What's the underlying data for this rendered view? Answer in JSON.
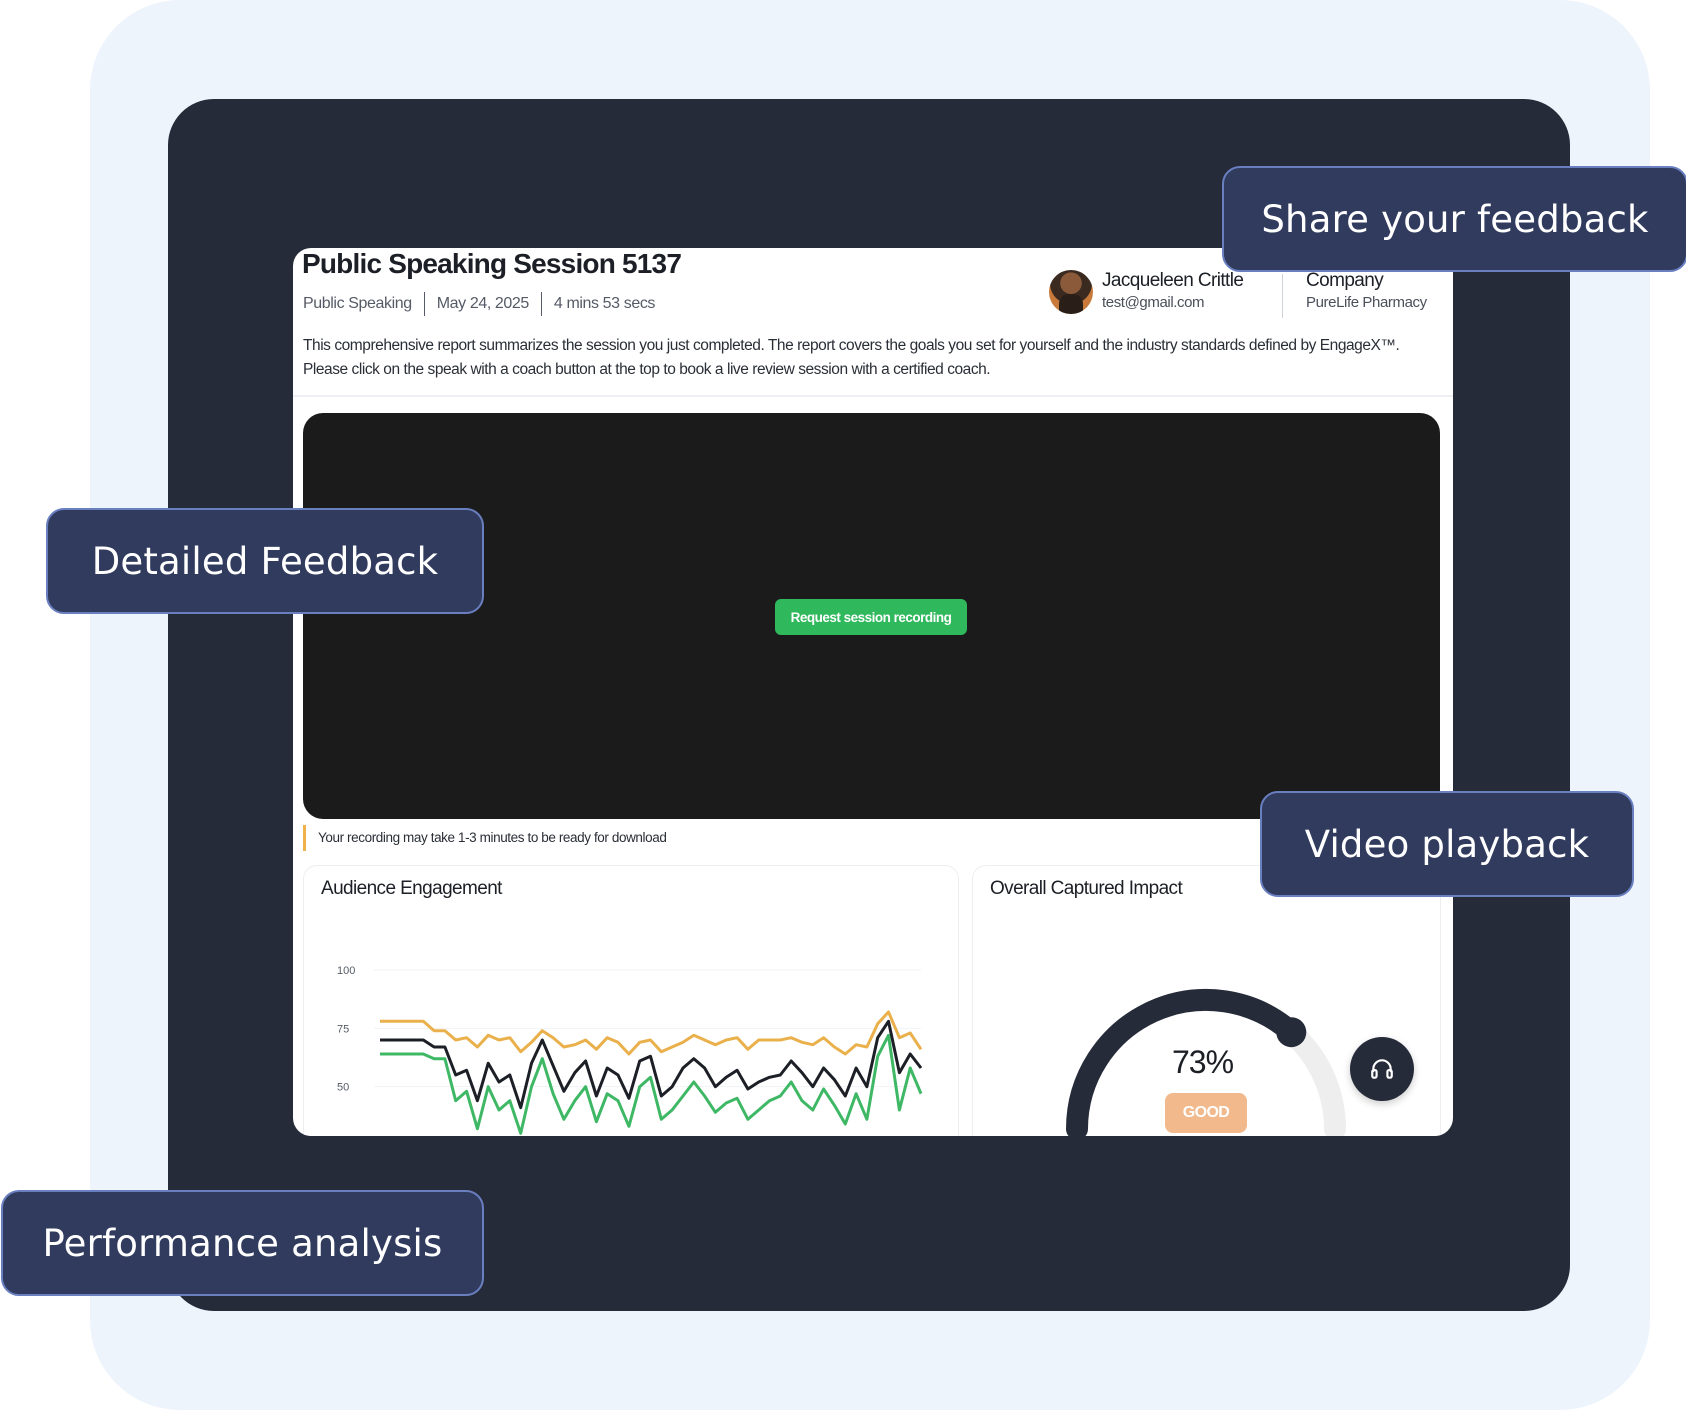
{
  "callouts": {
    "share_feedback": "Share your feedback",
    "detailed_feedback": "Detailed Feedback",
    "video_playback": "Video playback",
    "performance_analysis": "Performance analysis"
  },
  "report": {
    "title": "Public Speaking Session 5137",
    "category": "Public Speaking",
    "date": "May 24, 2025",
    "duration": "4 mins 53 secs",
    "description": "This comprehensive report summarizes the session you just completed. The report covers the goals you set for yourself and the industry standards defined by EngageX™. Please click on the speak with a coach button at the top to book a live review session with a certified coach."
  },
  "user": {
    "name": "Jacqueleen Crittle",
    "email": "test@gmail.com"
  },
  "company": {
    "label": "Company",
    "name": "PureLife Pharmacy"
  },
  "video": {
    "request_button": "Request session recording",
    "note": "Your recording may take 1-3 minutes to be ready for download"
  },
  "engagement_card": {
    "title": "Audience Engagement"
  },
  "impact_card": {
    "title": "Overall Captured Impact",
    "value": "73%",
    "level": 0.73,
    "badge": "GOOD"
  },
  "support": {
    "icon": "headset-icon"
  },
  "colors": {
    "accent_green": "#2fb85c",
    "series_orange": "#e9b04b",
    "series_black": "#1c1f26",
    "series_green": "#3fb866",
    "frame_dark": "#262b3a",
    "callout_bg": "#303b5e",
    "badge_good": "#f1b98c"
  },
  "chart_data": {
    "type": "line",
    "title": "Audience Engagement",
    "yticks": [
      "100",
      "75",
      "50"
    ],
    "ylim": [
      40,
      100
    ],
    "x": [
      0,
      1,
      2,
      3,
      4,
      5,
      6,
      7,
      8,
      9,
      10,
      11,
      12,
      13,
      14,
      15,
      16,
      17,
      18,
      19,
      20,
      21,
      22,
      23,
      24,
      25,
      26,
      27,
      28,
      29,
      30,
      31,
      32,
      33,
      34,
      35,
      36,
      37,
      38,
      39,
      40,
      41,
      42,
      43,
      44,
      45,
      46,
      47,
      48,
      49,
      50
    ],
    "series": [
      {
        "color": "#e9b04b",
        "values": [
          78,
          78,
          78,
          78,
          78,
          74,
          74,
          70,
          71,
          67,
          72,
          70,
          71,
          65,
          69,
          74,
          71,
          67,
          68,
          70,
          66,
          71,
          69,
          64,
          69,
          70,
          65,
          67,
          69,
          72,
          70,
          68,
          70,
          71,
          66,
          70,
          70,
          70,
          71,
          69,
          68,
          71,
          67,
          64,
          68,
          67,
          77,
          82,
          71,
          73,
          66
        ]
      },
      {
        "color": "#1c1f26",
        "values": [
          70,
          70,
          70,
          70,
          70,
          67,
          67,
          55,
          57,
          44,
          60,
          52,
          55,
          41,
          60,
          70,
          59,
          48,
          56,
          61,
          46,
          58,
          55,
          45,
          61,
          63,
          46,
          50,
          58,
          62,
          58,
          50,
          54,
          57,
          49,
          52,
          54,
          55,
          61,
          56,
          50,
          58,
          53,
          46,
          58,
          50,
          71,
          78,
          56,
          64,
          58
        ]
      },
      {
        "color": "#3fb866",
        "values": [
          64,
          64,
          64,
          64,
          64,
          62,
          62,
          44,
          48,
          32,
          50,
          40,
          44,
          30,
          50,
          62,
          47,
          36,
          44,
          50,
          35,
          47,
          44,
          33,
          50,
          54,
          36,
          40,
          46,
          52,
          46,
          39,
          43,
          45,
          36,
          40,
          44,
          46,
          52,
          44,
          40,
          49,
          42,
          34,
          47,
          36,
          63,
          72,
          40,
          58,
          47
        ]
      }
    ]
  }
}
